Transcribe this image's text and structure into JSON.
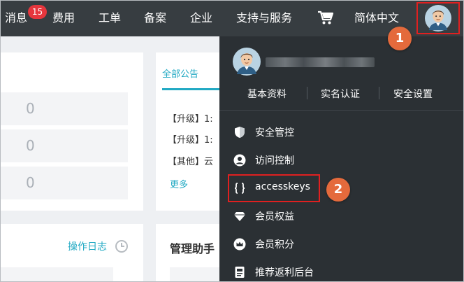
{
  "nav": {
    "messages_label": "消息",
    "messages_count": "15",
    "billing_label": "费用",
    "tickets_label": "工单",
    "filing_label": "备案",
    "enterprise_label": "企业",
    "support_label": "支持与服务",
    "language_label": "简体中文"
  },
  "stats": {
    "values": [
      "0",
      "0",
      "0"
    ]
  },
  "announcements": {
    "tab_all": "全部公告",
    "items": [
      "【升级】1:",
      "【升级】1:",
      "【其他】云"
    ],
    "more": "更多"
  },
  "activity": {
    "oplog_label": "操作日志"
  },
  "manager": {
    "title": "管理助手"
  },
  "dropdown": {
    "tabs": [
      "基本资料",
      "实名认证",
      "安全设置"
    ],
    "items": [
      {
        "label": "安全管控",
        "icon": "shield-icon"
      },
      {
        "label": "访问控制",
        "icon": "user-circle-icon"
      },
      {
        "label": "accesskeys",
        "icon": "braces-icon"
      },
      {
        "label": "会员权益",
        "icon": "diamond-icon"
      },
      {
        "label": "会员积分",
        "icon": "crown-icon"
      },
      {
        "label": "推荐返利后台",
        "icon": "document-icon"
      }
    ]
  },
  "callouts": {
    "step1": "1",
    "step2": "2"
  },
  "colors": {
    "nav_bg": "#373d41",
    "dropdown_bg": "#2b3034",
    "accent": "#21a9c3",
    "badge": "#e6363d",
    "highlight": "#e02020",
    "callout": "#e46a3c"
  }
}
